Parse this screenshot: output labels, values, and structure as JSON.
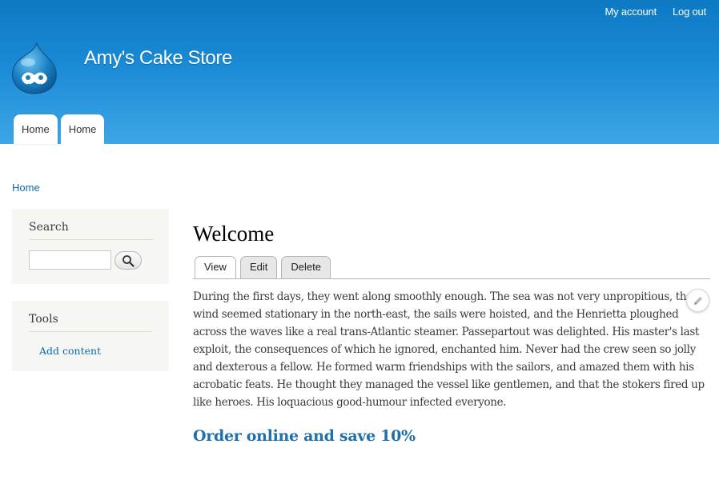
{
  "header": {
    "site_name": "Amy's Cake Store",
    "logo_icon": "drupal-drop-icon",
    "secondary_menu": [
      {
        "label": "My account"
      },
      {
        "label": "Log out"
      }
    ],
    "main_menu": [
      {
        "label": "Home"
      },
      {
        "label": "Home"
      }
    ],
    "colors": {
      "header_top": "#0d79c3",
      "header_bottom": "#3ea6e6",
      "link": "#0b6ab0"
    }
  },
  "breadcrumb": {
    "home": "Home"
  },
  "sidebar": {
    "search": {
      "title": "Search",
      "input_value": "",
      "button_icon": "magnifier-icon"
    },
    "tools": {
      "title": "Tools",
      "links": [
        {
          "label": "Add content"
        }
      ]
    }
  },
  "main": {
    "title": "Welcome",
    "tabs": [
      {
        "label": "View",
        "active": true
      },
      {
        "label": "Edit",
        "active": false
      },
      {
        "label": "Delete",
        "active": false
      }
    ],
    "body_lines": [
      "During the first days, they went along smoothly enough.  The sea was not very unpropitious, the",
      "wind seemed stationary in the north-east, the sails were hoisted, and the Henrietta ploughed",
      "across the waves like a real trans-Atlantic steamer. Passepartout was delighted.  His master's last",
      "exploit, the consequences of which he ignored, enchanted him.  Never had the crew seen so jolly",
      "and dexterous a fellow.  He formed warm friendships with the sailors, and amazed them with his",
      "acrobatic feats.  He thought they managed the vessel like gentlemen, and that the stokers fired up",
      "like heroes.  His loquacious good-humour infected everyone."
    ],
    "edit_icon": "pencil-icon",
    "promo": "Order online and save 10%"
  }
}
